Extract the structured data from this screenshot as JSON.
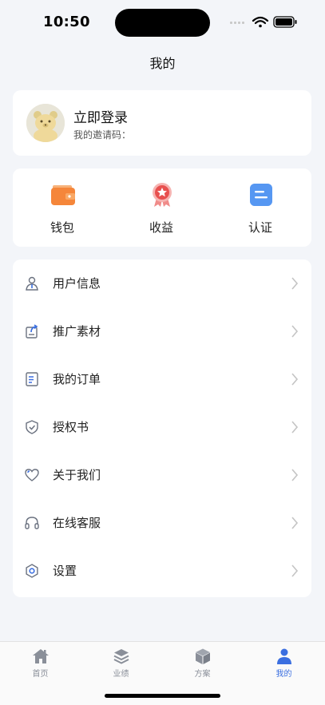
{
  "status_bar": {
    "time": "10:50"
  },
  "nav": {
    "title": "我的"
  },
  "profile": {
    "login_label": "立即登录",
    "invite_label": "我的邀请码："
  },
  "quick_actions": [
    {
      "label": "钱包",
      "icon": "wallet-icon"
    },
    {
      "label": "收益",
      "icon": "medal-icon"
    },
    {
      "label": "认证",
      "icon": "id-card-icon"
    }
  ],
  "menu": [
    {
      "label": "用户信息",
      "icon": "user-info-icon"
    },
    {
      "label": "推广素材",
      "icon": "share-material-icon"
    },
    {
      "label": "我的订单",
      "icon": "order-list-icon"
    },
    {
      "label": "授权书",
      "icon": "shield-check-icon"
    },
    {
      "label": "关于我们",
      "icon": "heart-icon"
    },
    {
      "label": "在线客服",
      "icon": "headset-icon"
    },
    {
      "label": "设置",
      "icon": "gear-icon"
    }
  ],
  "tabs": [
    {
      "label": "首页",
      "icon": "home-icon"
    },
    {
      "label": "业绩",
      "icon": "layers-icon"
    },
    {
      "label": "方案",
      "icon": "box-icon"
    },
    {
      "label": "我的",
      "icon": "person-icon",
      "active": true
    }
  ],
  "colors": {
    "accent": "#3b6fe0",
    "wallet": "#f5863a",
    "medal": "#e8504f",
    "id_card": "#4a8ef0",
    "background": "#f3f5f9"
  }
}
